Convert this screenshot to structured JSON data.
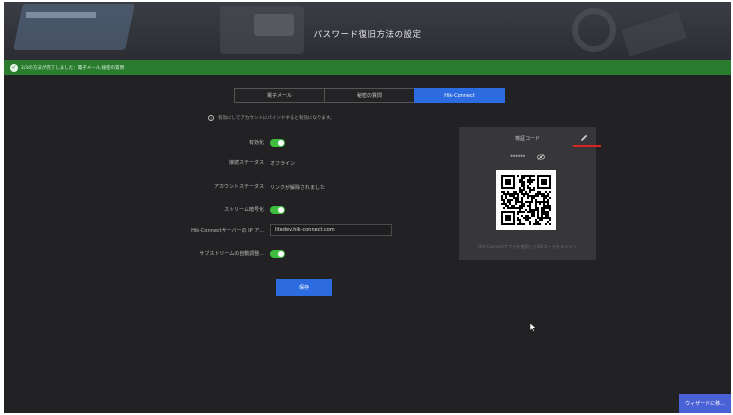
{
  "header": {
    "title": "パスワード復旧方法の設定"
  },
  "status_bar": {
    "icon": "check-icon",
    "message": "2/3の方法が完了しました：電子メール,秘密の質問",
    "color": "#2a7d2e"
  },
  "tabs": [
    {
      "label": "電子メール",
      "active": false
    },
    {
      "label": "秘密の質問",
      "active": false
    },
    {
      "label": "Hik-Connect",
      "active": true
    }
  ],
  "hint": {
    "icon": "info-icon",
    "text": "有効にしてアカウントにバインドすると有効になります。"
  },
  "form": {
    "enable_label": "有効化",
    "enable_on": true,
    "connection_status_label": "接続ステータス",
    "connection_status_value": "オフライン",
    "account_status_label": "アカウントステータス",
    "account_status_value": "リンクが解除されました",
    "stream_encryption_label": "ストリーム暗号化",
    "stream_encryption_on": true,
    "server_ip_label": "Hik-Connectサーバーの IP ア...",
    "server_ip_value": "litedev.hik-connect.com",
    "substream_label": "サブストリームの自動調整...",
    "substream_on": true
  },
  "save_label": "保存",
  "verification_panel": {
    "title": "検証コード",
    "masked_code": "******",
    "footer": "Hik-Connectアプリを使用してQRコードをスキャン"
  },
  "wizard_label": "ウィザードに移...",
  "colors": {
    "accent": "#2d6be0",
    "toggle_on": "#3fbf3f",
    "highlight": "#d8231f"
  }
}
